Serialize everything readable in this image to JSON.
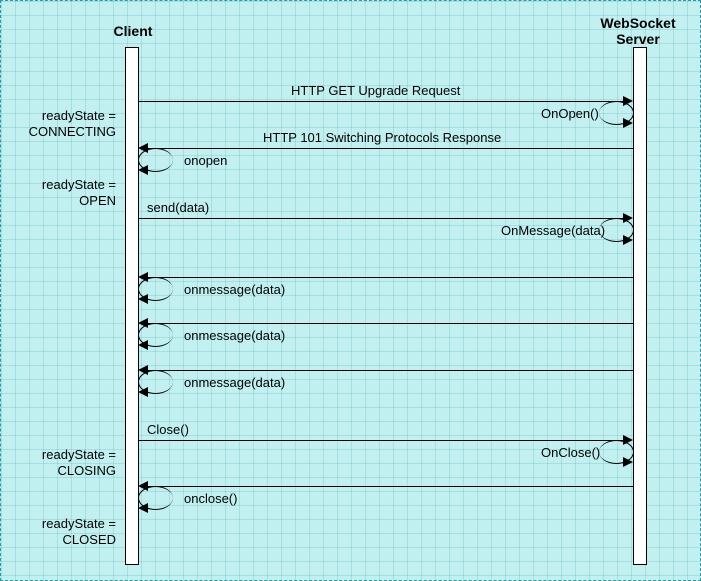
{
  "participants": {
    "client": "Client",
    "server": "WebSocket\nServer"
  },
  "states": {
    "connecting": "readyState =\nCONNECTING",
    "open": "readyState =\nOPEN",
    "closing": "readyState =\nCLOSING",
    "closed": "readyState =\nCLOSED"
  },
  "messages": {
    "httpGet": "HTTP GET Upgrade Request",
    "onOpenServer": "OnOpen()",
    "http101": "HTTP 101 Switching Protocols Response",
    "onopenClient": "onopen",
    "send": "send(data)",
    "onMessageServer": "OnMessage(data)",
    "onmessage1": "onmessage(data)",
    "onmessage2": "onmessage(data)",
    "onmessage3": "onmessage(data)",
    "close": "Close()",
    "onCloseServer": "OnClose()",
    "oncloseClient": "onclose()"
  },
  "chart_data": {
    "type": "sequence_diagram",
    "participants": [
      "Client",
      "WebSocket Server"
    ],
    "events": [
      {
        "from": "Client",
        "to": "WebSocket Server",
        "label": "HTTP GET Upgrade Request",
        "type": "message"
      },
      {
        "at": "Client",
        "state": "readyState = CONNECTING"
      },
      {
        "at": "WebSocket Server",
        "label": "OnOpen()",
        "type": "self"
      },
      {
        "from": "WebSocket Server",
        "to": "Client",
        "label": "HTTP 101 Switching Protocols Response",
        "type": "message"
      },
      {
        "at": "Client",
        "label": "onopen",
        "type": "self"
      },
      {
        "at": "Client",
        "state": "readyState = OPEN"
      },
      {
        "from": "Client",
        "to": "WebSocket Server",
        "label": "send(data)",
        "type": "message"
      },
      {
        "at": "WebSocket Server",
        "label": "OnMessage(data)",
        "type": "self"
      },
      {
        "from": "WebSocket Server",
        "to": "Client",
        "type": "message"
      },
      {
        "at": "Client",
        "label": "onmessage(data)",
        "type": "self"
      },
      {
        "from": "WebSocket Server",
        "to": "Client",
        "type": "message"
      },
      {
        "at": "Client",
        "label": "onmessage(data)",
        "type": "self"
      },
      {
        "from": "WebSocket Server",
        "to": "Client",
        "type": "message"
      },
      {
        "at": "Client",
        "label": "onmessage(data)",
        "type": "self"
      },
      {
        "from": "Client",
        "to": "WebSocket Server",
        "label": "Close()",
        "type": "message"
      },
      {
        "at": "Client",
        "state": "readyState = CLOSING"
      },
      {
        "at": "WebSocket Server",
        "label": "OnClose()",
        "type": "self"
      },
      {
        "from": "WebSocket Server",
        "to": "Client",
        "type": "message"
      },
      {
        "at": "Client",
        "label": "onclose()",
        "type": "self"
      },
      {
        "at": "Client",
        "state": "readyState = CLOSED"
      }
    ]
  }
}
